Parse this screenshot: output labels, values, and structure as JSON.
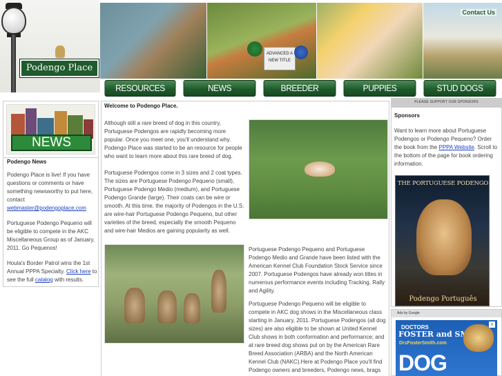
{
  "header": {
    "site_name": "Podengo Place",
    "contact_label": "Contact Us",
    "title_card_text": "ADVANCED A NEW TITLE"
  },
  "nav": {
    "items": [
      "RESOURCES",
      "NEWS",
      "BREEDER DIRECTORY",
      "PUPPIES",
      "STUD DOGS"
    ]
  },
  "left": {
    "banner_label": "NEWS",
    "heading": "Podengo News",
    "p1_text": "Podengo Place is live! If you have questions or comments or have something newsworthy to put here, contact ",
    "p1_email": "webmaster@podengoplace.com",
    "p2_text": "Portuguese Podengo Pequeno will be eligible to compete in the AKC Miscellaneous Group as of January, 2011. Go Pequenos!",
    "p3_a": "Houla's Border Patrol wins the 1st Annual PPPA Specialty. ",
    "p3_link1": "Click here",
    "p3_b": " to see the full ",
    "p3_link2": "catalog",
    "p3_c": " with results."
  },
  "main": {
    "welcome": "Welcome to Podengo Place.",
    "p1": "Although still a rare breed of dog in this country, Portuguese Podengos are rapidly becoming more popular. Once you meet one, you'll understand why. Podengo Place was started to be an resource for people who want to learn more about this rare breed of dog.",
    "p2": "Portuguese Podengos come in 3 sizes and 2 coat types. The sizes are Portuguese Podengo Pequeno (small), Portuguese Podengo Medio (medium), and Portuguese Podengo Grande (large). Their coats can be wire or smooth. At this time, the majority of Podengos in the U.S. are wire-hair Portuguese Podengo Pequeno, but other varieties of the breed, especially the smooth Pequeno and wire-hair Medios are gaining popularity as well.",
    "p3": "Portuguese Podengo Pequeno and Portuguese Podengo Medio and Grande have been listed with the American Kennel Club Foundation Stock Service since 2007. Portuguese Podengos have already won titles in numerous performance events including Tracking, Rally and Agility.",
    "p4": "Portuguese Podengo Pequeno will be eligible to compete in AKC dog shows in the Miscellaneous class starting in January, 2011. Portuguese Podengos (all dog sizes) are also eligible to be shown at United Kennel Club shows in both conformation and performance; and at rare breed dog shows put on by the American Rare Breed Association (ARBA) and the North American Kennel Club (NAKC).Here at Podengo Place you'll find Podengo owners and breeders, Podengo news, brags and any current Podengo happenings."
  },
  "right": {
    "support_label": "PLEASE SUPPORT OUR SPONSORS",
    "sponsor_heading": "Sponsors",
    "sponsor_a": "Want to learn more about Portuguese Podengos or Podengo Pequeno? Order the book from the ",
    "sponsor_link": "PPPA Website",
    "sponsor_b": ". Scroll to the bottom of the page for book ordering information.",
    "book_title": "THE PORTUGUESE PODENGO",
    "book_footer": "Podengo Português",
    "ads_label": "Ads by Google",
    "ad_line1": "DOCTORS",
    "ad_line2": "FOSTER and SMITH",
    "ad_line3": "DrsFosterSmith.com",
    "ad_big": "DOG",
    "ad_close": "x"
  },
  "colors": {
    "brand_green": "#1f5b2c",
    "link_blue": "#1a3fbf"
  }
}
